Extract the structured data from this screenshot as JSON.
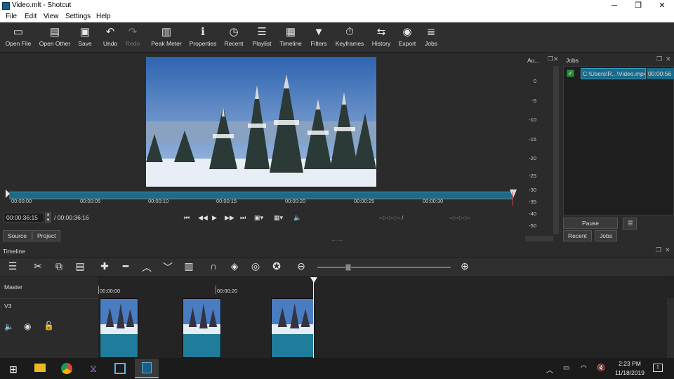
{
  "window": {
    "title": "Video.mlt - Shotcut",
    "minimize": "─",
    "maximize": "❐",
    "close": "✕"
  },
  "menu": [
    "File",
    "Edit",
    "View",
    "Settings",
    "Help"
  ],
  "toolbar": {
    "open_file": "Open File",
    "open_other": "Open Other",
    "save": "Save",
    "undo": "Undo",
    "redo": "Redo",
    "peak_meter": "Peak Meter",
    "properties": "Properties",
    "recent": "Recent",
    "playlist": "Playlist",
    "timeline": "Timeline",
    "filters": "Filters",
    "keyframes": "Keyframes",
    "history": "History",
    "export": "Export",
    "jobs": "Jobs"
  },
  "player": {
    "ruler_labels": [
      "00:00:00",
      "00:00:05",
      "00:00:10",
      "00:00:15",
      "00:00:20",
      "00:00:25",
      "00:00:30"
    ],
    "current_time": "00:00:36:15",
    "total_time": "/ 00:00:36:16",
    "in_point": "--:--:--:-- /",
    "out_point": "--:--:--:--",
    "source_tab": "Source",
    "project_tab": "Project"
  },
  "audio_meter": {
    "title": "Au...",
    "labels": [
      "0",
      "-5",
      "-10",
      "-15",
      "-20",
      "-25",
      "-30",
      "-35",
      "-40",
      "-50"
    ]
  },
  "jobs": {
    "title": "Jobs",
    "job_name": "C:\\Users\\R...\\Video.mp4",
    "job_time": "00:00:56",
    "pause_button": "Pause",
    "menu_button": "☰",
    "recent_tab": "Recent",
    "jobs_tab": "Jobs"
  },
  "timeline": {
    "title": "Timeline",
    "master_label": "Master",
    "track_name": "V3",
    "ruler_start": "00:00:00",
    "ruler_mid": "00:00:20"
  },
  "taskbar": {
    "time": "2:23 PM",
    "date": "11/18/2019",
    "notification_count": "1"
  },
  "colors": {
    "accent": "#1f6a86",
    "job_highlight": "#1b6a8a"
  }
}
